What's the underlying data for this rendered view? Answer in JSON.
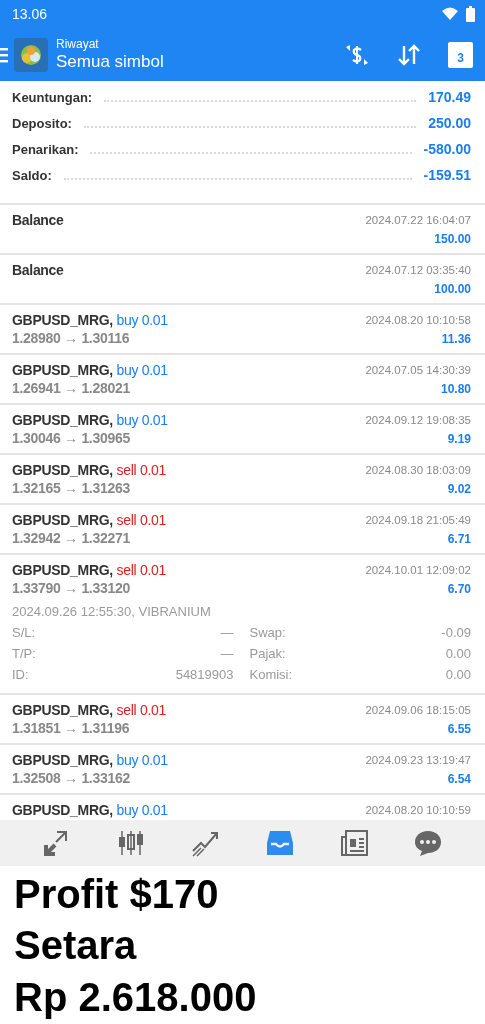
{
  "status_bar": {
    "time": "13.06"
  },
  "toolbar": {
    "subtitle": "Riwayat",
    "title": "Semua simbol",
    "calendar_day": "3"
  },
  "summary": [
    {
      "label": "Keuntungan:",
      "value": "170.49"
    },
    {
      "label": "Deposito:",
      "value": "250.00"
    },
    {
      "label": "Penarikan:",
      "value": "-580.00"
    },
    {
      "label": "Saldo:",
      "value": "-159.51"
    }
  ],
  "deals": [
    {
      "kind": "balance",
      "title": "Balance",
      "time": "2024.07.22 16:04:07",
      "amount": "150.00"
    },
    {
      "kind": "balance",
      "title": "Balance",
      "time": "2024.07.12 03:35:40",
      "amount": "100.00"
    },
    {
      "kind": "trade",
      "symbol": "GBPUSD_MRG,",
      "side": "buy",
      "volume": "0.01",
      "prices": "1.28980 → 1.30116",
      "time": "2024.08.20 10:10:58",
      "amount": "11.36"
    },
    {
      "kind": "trade",
      "symbol": "GBPUSD_MRG,",
      "side": "buy",
      "volume": "0.01",
      "prices": "1.26941 → 1.28021",
      "time": "2024.07.05 14:30:39",
      "amount": "10.80"
    },
    {
      "kind": "trade",
      "symbol": "GBPUSD_MRG,",
      "side": "buy",
      "volume": "0.01",
      "prices": "1.30046 → 1.30965",
      "time": "2024.09.12 19:08:35",
      "amount": "9.19"
    },
    {
      "kind": "trade",
      "symbol": "GBPUSD_MRG,",
      "side": "sell",
      "volume": "0.01",
      "prices": "1.32165 → 1.31263",
      "time": "2024.08.30 18:03:09",
      "amount": "9.02"
    },
    {
      "kind": "trade",
      "symbol": "GBPUSD_MRG,",
      "side": "sell",
      "volume": "0.01",
      "prices": "1.32942 → 1.32271",
      "time": "2024.09.18 21:05:49",
      "amount": "6.71"
    },
    {
      "kind": "trade",
      "symbol": "GBPUSD_MRG,",
      "side": "sell",
      "volume": "0.01",
      "prices": "1.33790 → 1.33120",
      "time": "2024.10.01 12:09:02",
      "amount": "6.70",
      "details": {
        "opened": "2024.09.26 12:55:30, VIBRANIUM",
        "left": [
          {
            "label": "S/L:",
            "value": "—"
          },
          {
            "label": "T/P:",
            "value": "—"
          },
          {
            "label": "ID:",
            "value": "54819903"
          }
        ],
        "right": [
          {
            "label": "Swap:",
            "value": "-0.09"
          },
          {
            "label": "Pajak:",
            "value": "0.00"
          },
          {
            "label": "Komisi:",
            "value": "0.00"
          }
        ]
      }
    },
    {
      "kind": "trade",
      "symbol": "GBPUSD_MRG,",
      "side": "sell",
      "volume": "0.01",
      "prices": "1.31851 → 1.31196",
      "time": "2024.09.06 18:15:05",
      "amount": "6.55"
    },
    {
      "kind": "trade",
      "symbol": "GBPUSD_MRG,",
      "side": "buy",
      "volume": "0.01",
      "prices": "1.32508 → 1.33162",
      "time": "2024.09.23 13:19:47",
      "amount": "6.54"
    },
    {
      "kind": "trade",
      "symbol": "GBPUSD_MRG,",
      "side": "buy",
      "volume": "0.01",
      "time": "2024.08.20 10:10:59"
    }
  ],
  "nav": [
    {
      "kind": "trade",
      "selected": false
    },
    {
      "kind": "quotes",
      "selected": false
    },
    {
      "kind": "chart",
      "selected": false
    },
    {
      "kind": "history",
      "selected": true
    },
    {
      "kind": "news",
      "selected": false
    },
    {
      "kind": "chat",
      "selected": false
    }
  ],
  "caption": {
    "lines": [
      "Profit $170",
      "Setara",
      "Rp 2.618.000"
    ]
  }
}
